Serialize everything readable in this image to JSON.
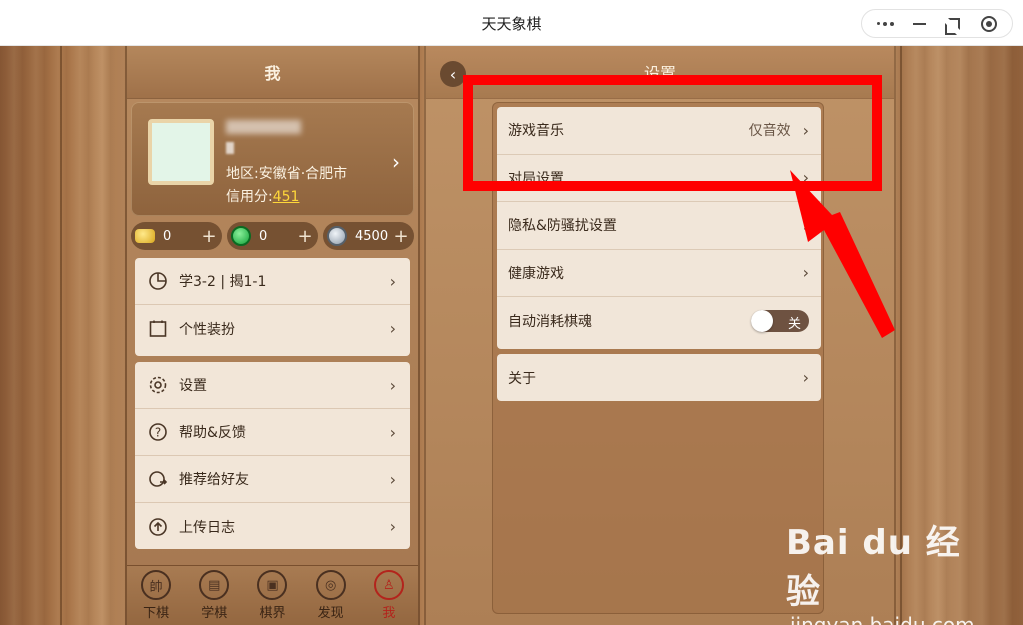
{
  "window": {
    "title": "天天象棋",
    "controls": [
      "more-icon",
      "minimize-icon",
      "restore-icon",
      "target-icon"
    ]
  },
  "left": {
    "header": "我",
    "profile": {
      "region": "地区:安徽省·合肥市",
      "credit_label": "信用分:",
      "credit_value": "451"
    },
    "currency": [
      {
        "icon": "gold-ingot-icon",
        "value": "0"
      },
      {
        "icon": "green-coin-icon",
        "value": "0"
      },
      {
        "icon": "silver-coin-icon",
        "value": "4500"
      }
    ],
    "menu1": [
      {
        "icon": "pie-chart-icon",
        "label": "学3-2 | 揭1-1"
      },
      {
        "icon": "frame-icon",
        "label": "个性装扮"
      }
    ],
    "menu2": [
      {
        "icon": "gear-icon",
        "label": "设置"
      },
      {
        "icon": "help-icon",
        "label": "帮助&反馈"
      },
      {
        "icon": "share-icon",
        "label": "推荐给好友"
      },
      {
        "icon": "upload-icon",
        "label": "上传日志"
      }
    ],
    "nav": [
      {
        "icon": "shuai-icon",
        "glyph": "帥",
        "label": "下棋"
      },
      {
        "icon": "book-icon",
        "glyph": "▤",
        "label": "学棋"
      },
      {
        "icon": "chat-icon",
        "glyph": "▣",
        "label": "棋界"
      },
      {
        "icon": "compass-icon",
        "glyph": "◎",
        "label": "发现"
      },
      {
        "icon": "user-icon",
        "glyph": "♙",
        "label": "我"
      }
    ]
  },
  "right": {
    "header": "设置",
    "menu1": [
      {
        "label": "游戏音乐",
        "value": "仅音效"
      },
      {
        "label": "对局设置",
        "value": ""
      },
      {
        "label": "隐私&防骚扰设置",
        "value": ""
      },
      {
        "label": "健康游戏",
        "value": ""
      },
      {
        "label": "自动消耗棋魂",
        "toggle": "关"
      }
    ],
    "menu2": [
      {
        "label": "关于"
      }
    ]
  },
  "watermark": {
    "brand": "Bai du 经验",
    "url": "jingyan.baidu.com"
  },
  "colors": {
    "annotation": "#ff0000",
    "credit_value": "#ffd83a",
    "active_nav": "#b3241c"
  }
}
